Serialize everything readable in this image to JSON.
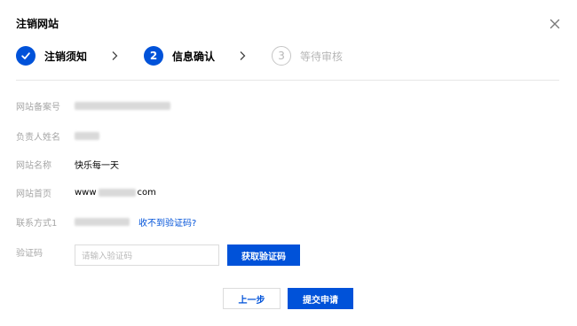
{
  "dialog": {
    "title": "注销网站",
    "close_icon": "close-icon"
  },
  "steps": [
    {
      "label": "注销须知",
      "state": "done",
      "marker": "✓"
    },
    {
      "label": "信息确认",
      "state": "active",
      "marker": "2"
    },
    {
      "label": "等待审核",
      "state": "pending",
      "marker": "3"
    }
  ],
  "form": {
    "filing_number": {
      "label": "网站备案号"
    },
    "owner_name": {
      "label": "负责人姓名"
    },
    "site_name": {
      "label": "网站名称",
      "value": "快乐每一天"
    },
    "homepage": {
      "label": "网站首页",
      "prefix": "www",
      "suffix": "com"
    },
    "contact": {
      "label": "联系方式1",
      "link": "收不到验证码?"
    },
    "code": {
      "label": "验证码",
      "placeholder": "请输入验证码",
      "get_code_label": "获取验证码"
    }
  },
  "footer": {
    "prev_label": "上一步",
    "submit_label": "提交申请"
  },
  "colors": {
    "primary": "#0052d9",
    "muted_text": "#a6a6a6",
    "border": "#dcdcdc"
  }
}
